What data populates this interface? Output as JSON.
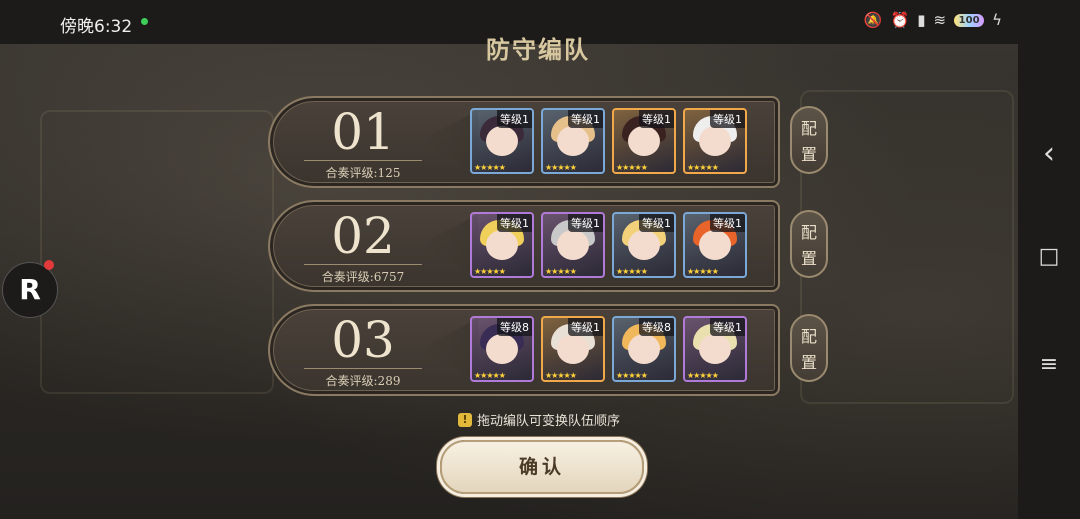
{
  "status_bar": {
    "time": "傍晚6:32",
    "battery": "100"
  },
  "title": "防守编队",
  "teams": [
    {
      "number": "01",
      "score": "合奏评级:125",
      "members": [
        {
          "level": "等级1",
          "frame": "#7aa9d8",
          "hair": "#3b2a3a"
        },
        {
          "level": "等级1",
          "frame": "#7aa9d8",
          "hair": "#e6c08a"
        },
        {
          "level": "等级1",
          "frame": "#f0a84a",
          "hair": "#3a2220"
        },
        {
          "level": "等级1",
          "frame": "#f0a84a",
          "hair": "#eeeeee"
        }
      ]
    },
    {
      "number": "02",
      "score": "合奏评级:6757",
      "members": [
        {
          "level": "等级1",
          "frame": "#b07ad8",
          "hair": "#f0cf5a"
        },
        {
          "level": "等级1",
          "frame": "#b07ad8",
          "hair": "#c9c9c9"
        },
        {
          "level": "等级1",
          "frame": "#7aa9d8",
          "hair": "#f2d17a"
        },
        {
          "level": "等级1",
          "frame": "#7aa9d8",
          "hair": "#e8642a"
        }
      ]
    },
    {
      "number": "03",
      "score": "合奏评级:289",
      "members": [
        {
          "level": "等级8",
          "frame": "#b07ad8",
          "hair": "#3a2d55"
        },
        {
          "level": "等级1",
          "frame": "#f0a84a",
          "hair": "#e8e0d4"
        },
        {
          "level": "等级8",
          "frame": "#7aa9d8",
          "hair": "#f0b85a"
        },
        {
          "level": "等级1",
          "frame": "#b07ad8",
          "hair": "#eadfae"
        }
      ]
    }
  ],
  "configure_label": "配置",
  "hint": "拖动编队可变换队伍顺序",
  "confirm": "确认",
  "floating_button": "R",
  "nav": {
    "back": "‹",
    "home": "□",
    "menu": "≡"
  }
}
